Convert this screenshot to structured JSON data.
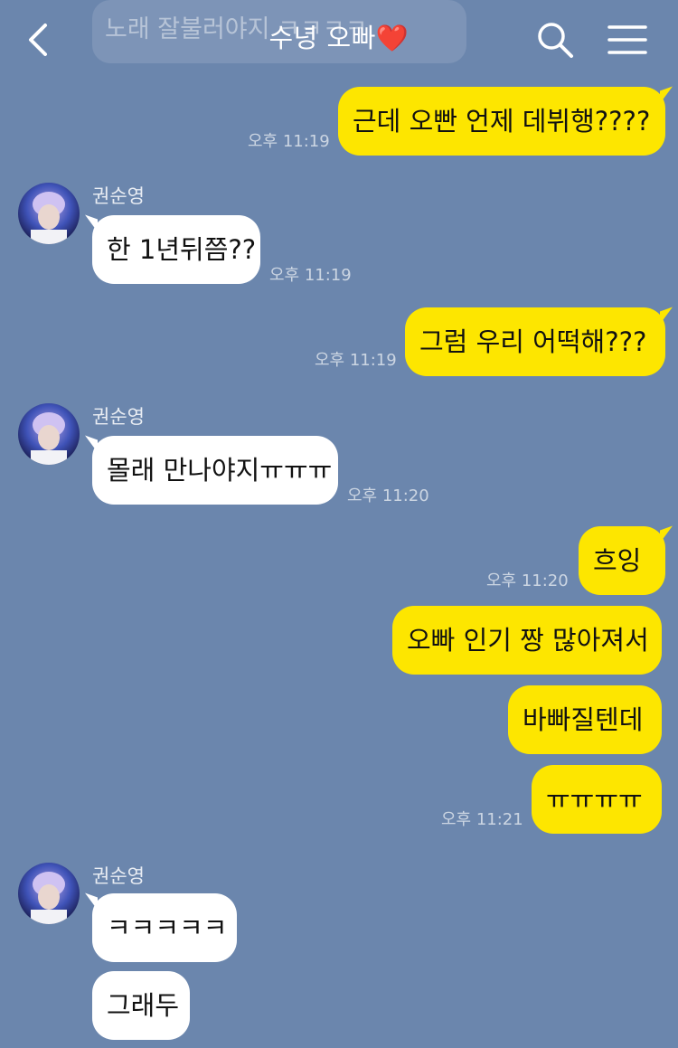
{
  "header": {
    "title": "수녕 오빠",
    "title_emoji": "❤️"
  },
  "ghost_message": "노래 잘불러야지 ㅋㅋㅋㅋ",
  "messages": [
    {
      "text": "근데 오빤 언제 데뷔행????",
      "time": "오후 11:19"
    },
    {
      "sender": "권순영",
      "text": "한 1년뒤쯤??",
      "time": "오후 11:19"
    },
    {
      "text": "그럼 우리 어떡해???",
      "time": "오후 11:19"
    },
    {
      "sender": "권순영",
      "text": "몰래 만나야지ㅠㅠㅠ",
      "time": "오후 11:20"
    },
    {
      "text": "흐잉",
      "time": "오후 11:20"
    },
    {
      "text": "오빠 인기 짱 많아져서"
    },
    {
      "text": "바빠질텐데"
    },
    {
      "text": "ㅠㅠㅠㅠ",
      "time": "오후 11:21"
    },
    {
      "sender": "권순영",
      "text": "ㅋㅋㅋㅋㅋ"
    },
    {
      "text": "그래두"
    }
  ],
  "colors": {
    "background": "#6b86ad",
    "my_bubble": "#fde600",
    "other_bubble": "#ffffff"
  },
  "icons": [
    "back-arrow-icon",
    "search-icon",
    "menu-icon"
  ]
}
